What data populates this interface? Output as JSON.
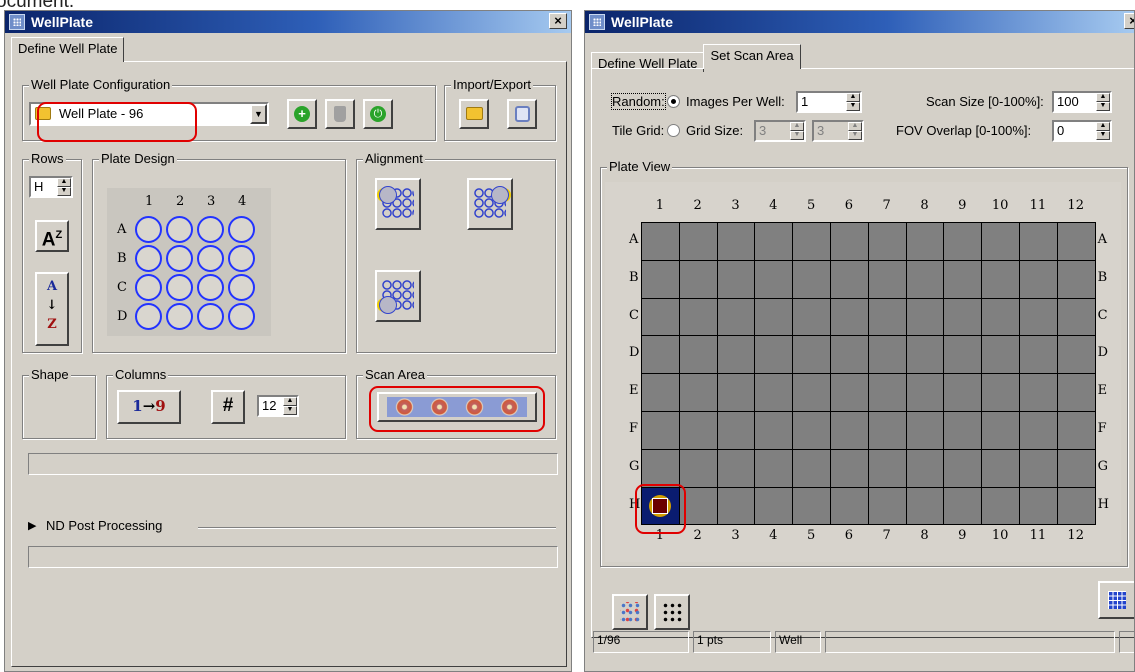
{
  "top_fragment": "ocument.",
  "left": {
    "title": "WellPlate",
    "close": "×",
    "tabs": [
      "Define Well Plate"
    ],
    "config_group": "Well Plate Configuration",
    "plate_select": "Well Plate - 96",
    "import_export": "Import/Export",
    "rows_group": "Rows",
    "rows_value": "H",
    "az_label": "A",
    "az_sup": "Z",
    "sort_a": "A",
    "sort_arrow": "↓",
    "sort_z": "Z",
    "plate_design": "Plate Design",
    "design_cols": [
      "1",
      "2",
      "3",
      "4"
    ],
    "design_rows": [
      "A",
      "B",
      "C",
      "D"
    ],
    "alignment": "Alignment",
    "shape": "Shape",
    "columns": "Columns",
    "columns_num_start": "1",
    "columns_arrow": "→",
    "columns_num_end": "9",
    "hash": "#",
    "columns_value": "12",
    "scan_area": "Scan Area",
    "nd_post": "ND Post Processing"
  },
  "right": {
    "title": "WellPlate",
    "close": "×",
    "tabs": [
      "Define Well Plate",
      "Set Scan Area"
    ],
    "random_label": "Random:",
    "images_per_well_label": "Images Per Well:",
    "images_per_well_value": "1",
    "scan_size_label": "Scan Size [0-100%]:",
    "scan_size_value": "100",
    "tile_grid_label": "Tile Grid:",
    "grid_size_label": "Grid Size:",
    "grid_size_x": "3",
    "grid_size_y": "3",
    "fov_overlap_label": "FOV Overlap [0-100%]:",
    "fov_overlap_value": "0",
    "plate_view": "Plate View",
    "columns": [
      "1",
      "2",
      "3",
      "4",
      "5",
      "6",
      "7",
      "8",
      "9",
      "10",
      "11",
      "12"
    ],
    "rows": [
      "A",
      "B",
      "C",
      "D",
      "E",
      "F",
      "G",
      "H"
    ],
    "status": [
      "1/96",
      "1 pts",
      "Well",
      "",
      ""
    ]
  },
  "colors": {
    "titlebar": "#0a246a",
    "face": "#d4d0c8",
    "highlight": "#e00000",
    "well": "#2233ff",
    "selected_well": "#0a1c70"
  }
}
